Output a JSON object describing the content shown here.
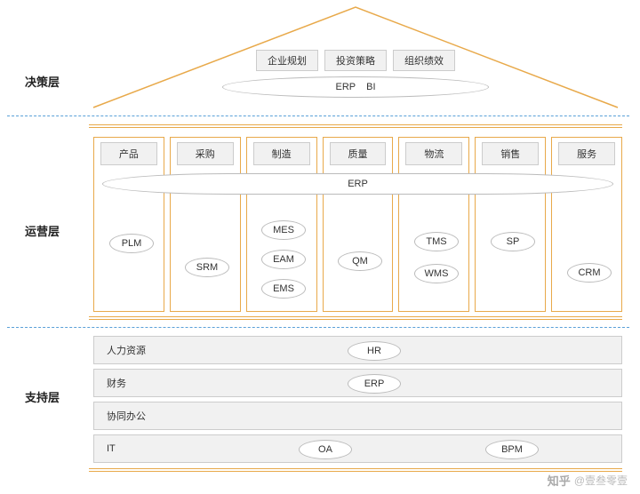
{
  "layers": {
    "decision": "决策层",
    "operations": "运营层",
    "support": "支持层"
  },
  "roof": {
    "boxes": [
      "企业规划",
      "投资策略",
      "组织绩效"
    ],
    "systems": [
      "ERP",
      "BI"
    ]
  },
  "ops": {
    "columns": [
      "产品",
      "采购",
      "制造",
      "质量",
      "物流",
      "销售",
      "服务"
    ],
    "erp_band": "ERP",
    "col0": [
      "PLM"
    ],
    "col1": [
      "SRM"
    ],
    "col2": [
      "MES",
      "EAM",
      "EMS"
    ],
    "col3": [
      "QM"
    ],
    "col4": [
      "TMS",
      "WMS"
    ],
    "col5": [
      "SP"
    ],
    "col6": [
      "CRM"
    ]
  },
  "support": {
    "rows": [
      {
        "label": "人力资源",
        "systems": [
          "HR"
        ]
      },
      {
        "label": "财务",
        "systems": [
          "ERP"
        ]
      },
      {
        "label": "协同办公",
        "systems": []
      },
      {
        "label": "IT",
        "systems": [
          "OA",
          "BPM"
        ]
      }
    ]
  },
  "watermark": "@壹叁零壹"
}
